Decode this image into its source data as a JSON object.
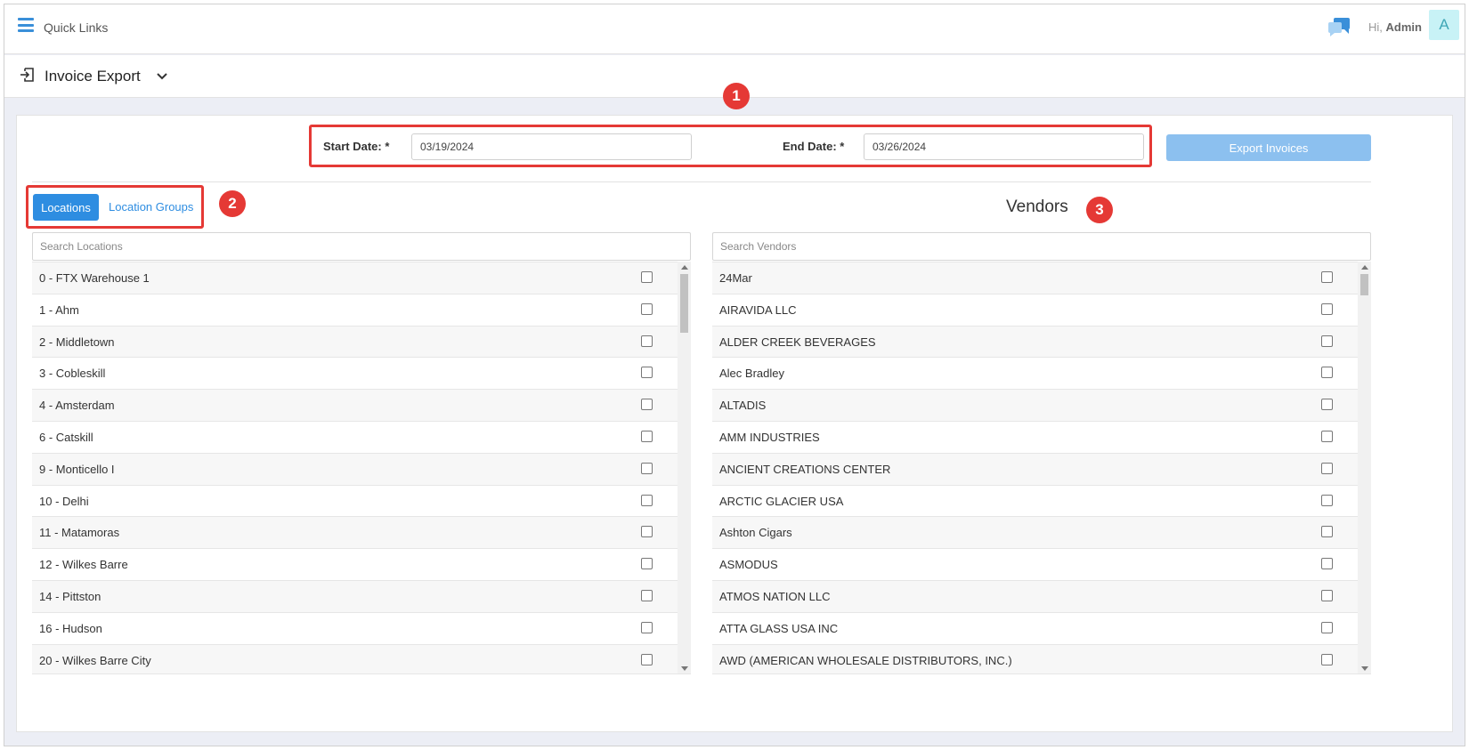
{
  "header": {
    "quick_links": "Quick Links",
    "greeting_prefix": "Hi,",
    "user_name": "Admin",
    "avatar_letter": "A"
  },
  "page": {
    "title": "Invoice Export"
  },
  "filters": {
    "start_label": "Start Date: *",
    "start_value": "03/19/2024",
    "end_label": "End Date: *",
    "end_value": "03/26/2024"
  },
  "export_button": "Export Invoices",
  "annotations": [
    "1",
    "2",
    "3"
  ],
  "tabs": {
    "active": "Locations",
    "other": "Location Groups"
  },
  "vendors_title": "Vendors",
  "locations": {
    "placeholder": "Search Locations",
    "items": [
      "0 - FTX Warehouse 1",
      "1 - Ahm",
      "2 - Middletown",
      "3 - Cobleskill",
      "4 - Amsterdam",
      "6 - Catskill",
      "9 - Monticello I",
      "10 - Delhi",
      "11 - Matamoras",
      "12 - Wilkes Barre",
      "14 - Pittston",
      "16 - Hudson",
      "20 - Wilkes Barre City"
    ]
  },
  "vendors": {
    "placeholder": "Search Vendors",
    "items": [
      "24Mar",
      "AIRAVIDA LLC",
      "ALDER CREEK BEVERAGES",
      "Alec Bradley",
      "ALTADIS",
      "AMM INDUSTRIES",
      "ANCIENT CREATIONS CENTER",
      "ARCTIC GLACIER USA",
      "Ashton Cigars",
      "ASMODUS",
      "ATMOS NATION LLC",
      "ATTA GLASS USA INC",
      "AWD (AMERICAN WHOLESALE DISTRIBUTORS, INC.)"
    ]
  },
  "colors": {
    "primary": "#2e8de1",
    "export_button": "#8cc0ef",
    "annotation": "#e53935",
    "avatar_bg": "#c8f2f6"
  },
  "icons": [
    "menu-icon",
    "chat-icon",
    "export-icon",
    "chevron-down-icon",
    "checkbox",
    "scroll-up-arrow",
    "scroll-down-arrow"
  ]
}
